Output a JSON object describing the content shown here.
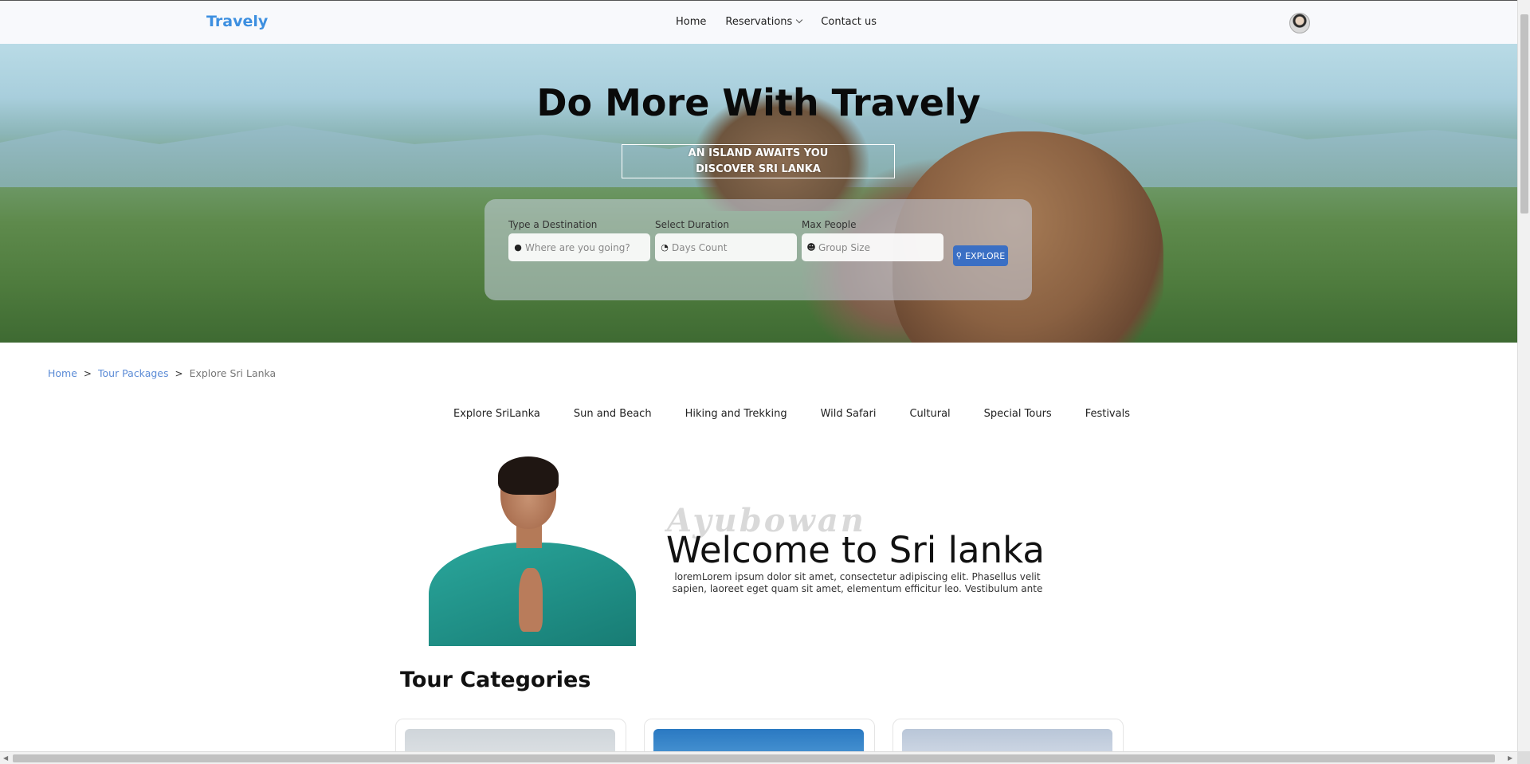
{
  "navbar": {
    "brand": "Travely",
    "links": [
      {
        "label": "Home"
      },
      {
        "label": "Reservations"
      },
      {
        "label": "Contact us"
      }
    ]
  },
  "hero": {
    "title": "Do More With Travely",
    "subtitle_line1": "AN ISLAND AWAITS YOU",
    "subtitle_line2": "DISCOVER SRI LANKA",
    "search": {
      "destination": {
        "label": "Type a Destination",
        "placeholder": "Where are you going?",
        "icon": "map-pin-icon"
      },
      "duration": {
        "label": "Select Duration",
        "placeholder": "Days Count",
        "icon": "clock-icon"
      },
      "people": {
        "label": "Max People",
        "placeholder": "Group Size",
        "icon": "users-icon"
      },
      "button": "EXPLORE",
      "button_icon": "search-icon"
    }
  },
  "breadcrumb": {
    "home": "Home",
    "packages": "Tour Packages",
    "current": "Explore Sri Lanka"
  },
  "categories": [
    "Explore SriLanka",
    "Sun and Beach",
    "Hiking and Trekking",
    "Wild Safari",
    "Cultural",
    "Special Tours",
    "Festivals"
  ],
  "welcome": {
    "script": "Ayubowan",
    "title_part1": "Welcome to ",
    "title_part2": "Sri lanka",
    "text": "loremLorem ipsum dolor sit amet, consectetur adipiscing elit. Phasellus velit sapien, laoreet eget quam sit amet, elementum efficitur leo. Vestibulum ante"
  },
  "tour_categories": {
    "title": "Tour Categories"
  },
  "colors": {
    "brand": "#3d8fe0",
    "button": "#3a6fc4",
    "link": "#5b8bd6"
  }
}
